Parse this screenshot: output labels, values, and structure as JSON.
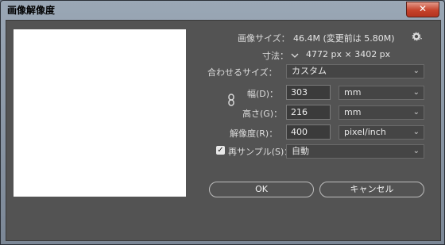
{
  "window": {
    "title": "画像解像度",
    "close_label": "✕"
  },
  "image_size": {
    "label": "画像サイズ：",
    "value": "46.4M (変更前は 5.80M)",
    "settings_icon": "gear-icon"
  },
  "dimensions": {
    "label": "寸法：",
    "value": "4772 px × 3402 px"
  },
  "fit_to": {
    "label": "合わせるサイズ：",
    "value": "カスタム"
  },
  "width": {
    "label": "幅(D)：",
    "value": "303",
    "unit": "mm"
  },
  "height": {
    "label": "高さ(G)：",
    "value": "216",
    "unit": "mm"
  },
  "resolution": {
    "label": "解像度(R)：",
    "value": "400",
    "unit": "pixel/inch"
  },
  "resample": {
    "label": "再サンプル(S)：",
    "value": "自動",
    "checked": true
  },
  "buttons": {
    "ok": "OK",
    "cancel": "キャンセル"
  },
  "colors": {
    "panel": "#535353",
    "input_bg": "#3b3b3b",
    "title_gradient_top": "#9aa7b5",
    "close_red": "#c6432c"
  }
}
